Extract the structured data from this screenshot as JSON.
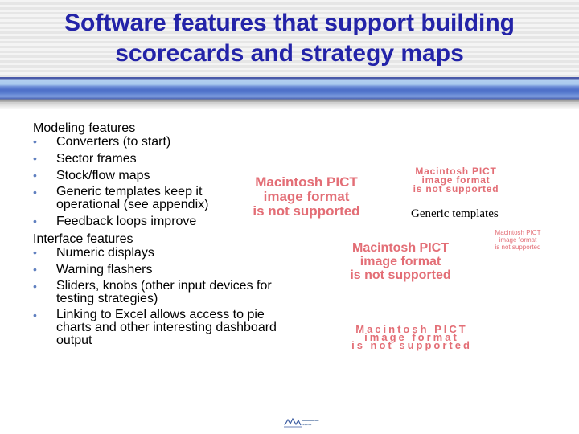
{
  "title": {
    "line1": "Software features that support building",
    "line2": "scorecards and strategy maps"
  },
  "modeling": {
    "heading": "Modeling features",
    "items": [
      {
        "text": "Converters (to start)",
        "bullet": "•"
      },
      {
        "text": "Sector frames",
        "bullet": "•"
      },
      {
        "text": "Stock/flow maps",
        "bullet": "•"
      },
      {
        "text": "Generic templates keep it operational (see appendix)",
        "bullet": "•"
      }
    ],
    "trailing_item": {
      "text": "Feedback loops improve",
      "bullet": "•"
    }
  },
  "interface": {
    "heading": "Interface features",
    "items": [
      {
        "text": "Numeric displays",
        "bullet": "•"
      },
      {
        "text": "Warning flashers",
        "bullet": "•"
      },
      {
        "text": "Sliders, knobs (other input devices for testing strategies)",
        "bullet": "•"
      },
      {
        "text": "Linking to Excel allows access to pie charts and other interesting dashboard output",
        "bullet": "•"
      }
    ]
  },
  "placeholders": {
    "line1": "Macintosh PICT",
    "line2": "image format",
    "line3": "is not supported"
  },
  "caption": "Generic templates",
  "colors": {
    "title": "#2323a8",
    "bullet": "#5f7fbf",
    "placeholder": "#e36e76"
  },
  "footer": {
    "logo_icon": "mountain-logo-icon"
  }
}
